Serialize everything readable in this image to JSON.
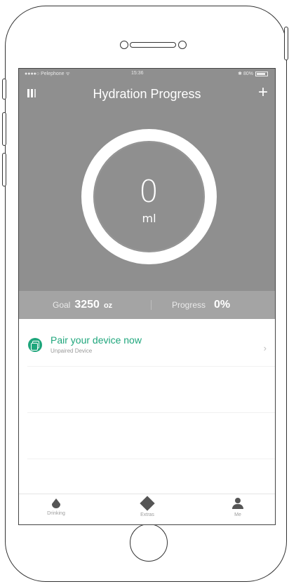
{
  "status_bar": {
    "carrier": "●●●●○ Pelephone ᯤ",
    "time": "15:36",
    "battery": "✱ 80%"
  },
  "nav": {
    "title": "Hydration Progress",
    "menu_icon": "menu-bars-icon",
    "add_icon": "plus-icon",
    "add_symbol": "+"
  },
  "ring": {
    "value": "0",
    "unit": "ml",
    "progress_fraction": 0
  },
  "stats": {
    "goal_label": "Goal",
    "goal_value": "3250",
    "goal_unit": "oz",
    "progress_label": "Progress",
    "progress_value": "0%"
  },
  "pair": {
    "title": "Pair your device now",
    "subtitle": "Unpaired Device",
    "chevron": "›",
    "icon": "device-pair-icon"
  },
  "tabs": [
    {
      "label": "Drinking",
      "icon": "water-drop-icon"
    },
    {
      "label": "Extras",
      "icon": "extras-grid-icon"
    },
    {
      "label": "Me",
      "icon": "person-icon"
    }
  ],
  "colors": {
    "header_bg": "#8f8f8f",
    "stats_bg": "#a4a4a4",
    "accent": "#1fa67c"
  }
}
